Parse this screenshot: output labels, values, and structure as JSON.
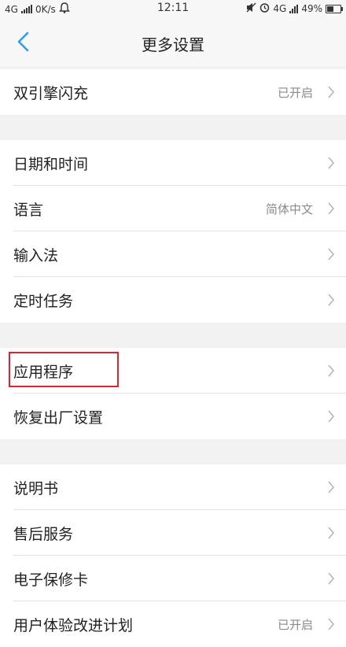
{
  "status_bar": {
    "network_left": "4G",
    "speed": "0K/s",
    "time": "12:11",
    "network_right": "4G",
    "battery": "49%",
    "battery_level": 0.49
  },
  "header": {
    "title": "更多设置"
  },
  "sections": [
    {
      "items": [
        {
          "label": "双引擎闪充",
          "value": "已开启"
        }
      ]
    },
    {
      "items": [
        {
          "label": "日期和时间",
          "value": ""
        },
        {
          "label": "语言",
          "value": "简体中文"
        },
        {
          "label": "输入法",
          "value": ""
        },
        {
          "label": "定时任务",
          "value": ""
        }
      ]
    },
    {
      "items": [
        {
          "label": "应用程序",
          "value": "",
          "highlighted": true
        },
        {
          "label": "恢复出厂设置",
          "value": ""
        }
      ]
    },
    {
      "items": [
        {
          "label": "说明书",
          "value": ""
        },
        {
          "label": "售后服务",
          "value": ""
        },
        {
          "label": "电子保修卡",
          "value": ""
        },
        {
          "label": "用户体验改进计划",
          "value": "已开启"
        }
      ]
    }
  ],
  "colors": {
    "accent": "#2f9cf0",
    "highlight": "#e8202a"
  }
}
